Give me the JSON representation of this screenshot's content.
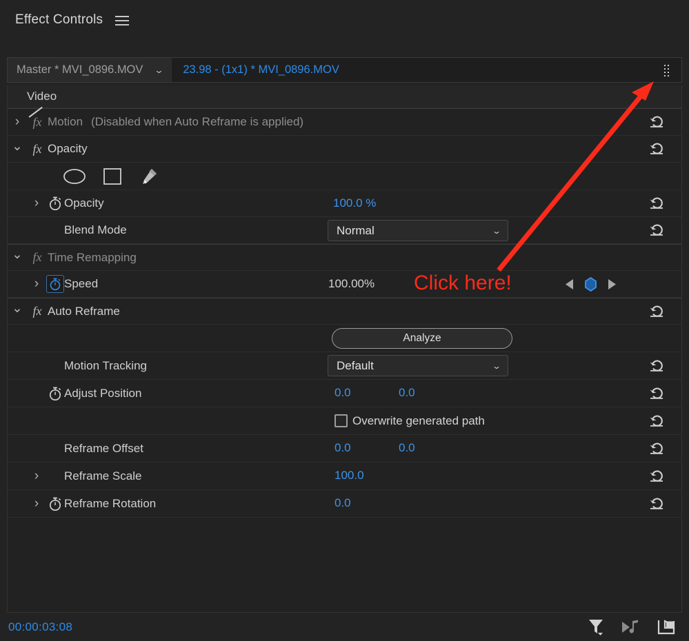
{
  "panel": {
    "title": "Effect Controls",
    "menu_icon": "hamburger-menu-icon"
  },
  "clip_selector": {
    "master_label": "Master * MVI_0896.MOV",
    "sequence_label": "23.98 - (1x1) * MVI_0896.MOV",
    "master_caret": "⌄",
    "grip_icon": "drag-grip-icon"
  },
  "section_header": {
    "video": "Video"
  },
  "effects": {
    "motion": {
      "label": "Motion",
      "note": "(Disabled when Auto Reframe is applied)",
      "fx": "fx"
    },
    "opacity": {
      "label": "Opacity",
      "fx": "fx",
      "mask_tools": [
        "ellipse-mask-tool",
        "rectangle-mask-tool",
        "pen-mask-tool"
      ],
      "opacity_param": {
        "label": "Opacity",
        "value": "100.0 %"
      },
      "blend_mode": {
        "label": "Blend Mode",
        "value": "Normal",
        "caret": "⌄"
      }
    },
    "time_remapping": {
      "label": "Time Remapping",
      "fx": "fx",
      "speed": {
        "label": "Speed",
        "value": "100.00%"
      }
    },
    "auto_reframe": {
      "label": "Auto Reframe",
      "fx": "fx",
      "analyze_button": "Analyze",
      "motion_tracking": {
        "label": "Motion Tracking",
        "value": "Default",
        "caret": "⌄"
      },
      "adjust_position": {
        "label": "Adjust Position",
        "value_x": "0.0",
        "value_y": "0.0"
      },
      "overwrite": {
        "label": "Overwrite generated path",
        "checked": false
      },
      "reframe_offset": {
        "label": "Reframe Offset",
        "value_x": "0.0",
        "value_y": "0.0"
      },
      "reframe_scale": {
        "label": "Reframe Scale",
        "value": "100.0"
      },
      "reframe_rotation": {
        "label": "Reframe Rotation",
        "value": "0.0"
      }
    }
  },
  "keyframe_nav": {
    "prev_icon": "previous-keyframe-icon",
    "marker_icon": "keyframe-diamond-icon",
    "next_icon": "next-keyframe-icon"
  },
  "reset_icon_name": "reset-parameter-icon",
  "bottom_bar": {
    "timecode": "00:00:03:08",
    "icons": [
      "filter-funnel-icon",
      "audio-transition-icon",
      "export-frame-icon"
    ]
  },
  "annotation": {
    "text": "Click here!",
    "color": "#fb2b1b",
    "arrow": "red-pointer-arrow"
  },
  "colors": {
    "accent_blue": "#2d8ceb",
    "value_blue": "#3d93e8",
    "panel_bg": "#232323",
    "list_bg": "#222222",
    "annotation_red": "#fb2b1b"
  }
}
